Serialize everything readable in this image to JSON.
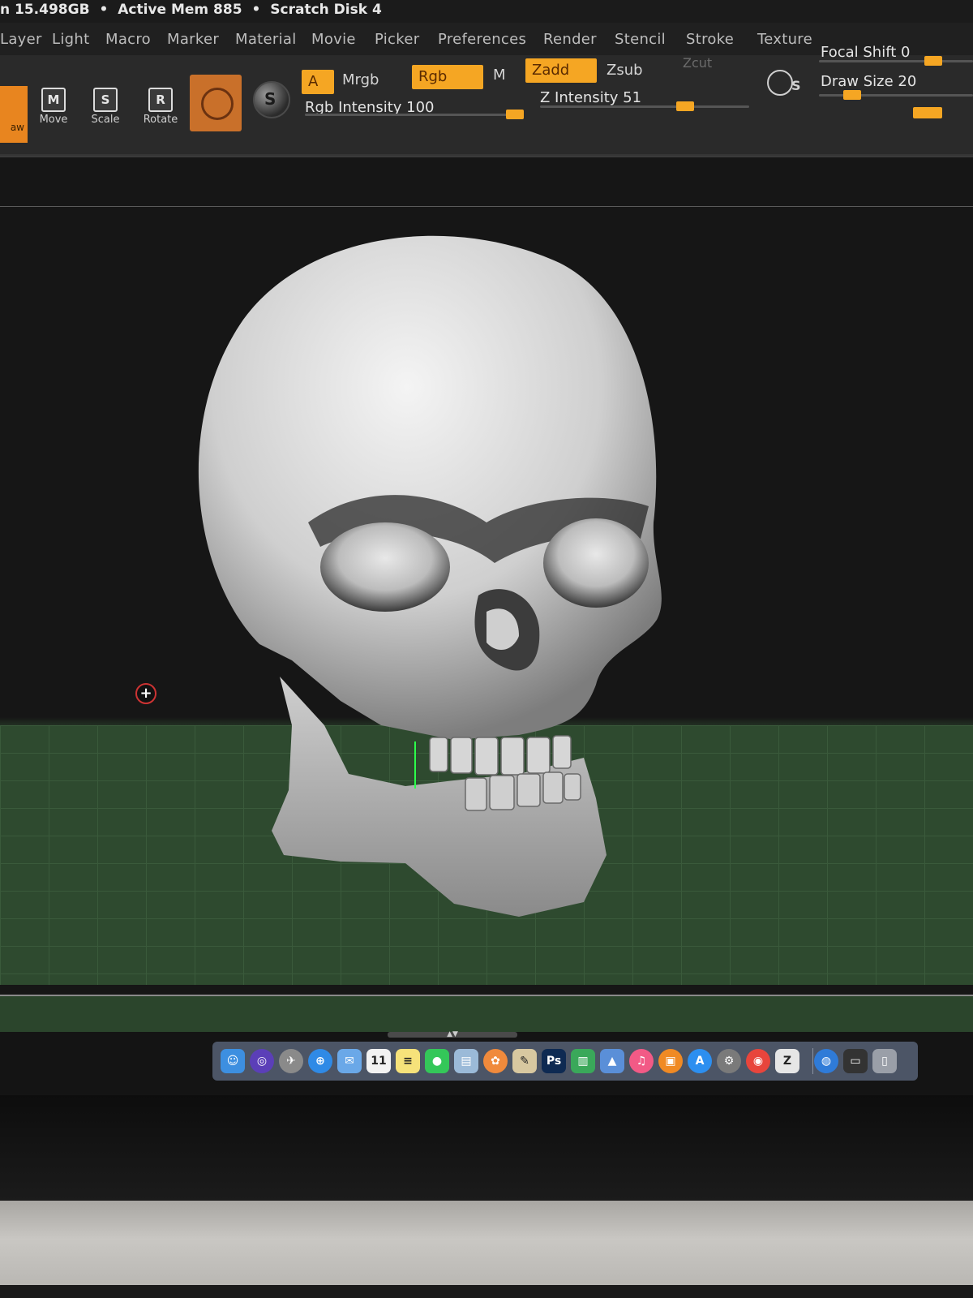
{
  "status_bar": {
    "mem_text": "n 15.498GB",
    "bullet": "•",
    "active_mem_text": "Active Mem 885",
    "scratch_text": "Scratch Disk 4"
  },
  "menu": {
    "items": [
      "Layer",
      "Light",
      "Macro",
      "Marker",
      "Material",
      "Movie",
      "Picker",
      "Preferences",
      "Render",
      "Stencil",
      "Stroke",
      "Texture"
    ]
  },
  "toolbar": {
    "draw_label": "aw",
    "move_label": "Move",
    "move_glyph": "M",
    "scale_label": "Scale",
    "scale_glyph": "S",
    "rotate_label": "Rotate",
    "rotate_glyph": "R",
    "sphere_glyph": "S",
    "a_label": "A",
    "mrgb_label": "Mrgb",
    "rgb_label": "Rgb",
    "m_label": "M",
    "zadd_label": "Zadd",
    "zsub_label": "Zsub",
    "zcut_label": "Zcut",
    "rgb_intensity_label": "Rgb Intensity 100",
    "rgb_intensity_value": 100,
    "z_intensity_label": "Z Intensity 51",
    "z_intensity_value": 51,
    "focal_shift_label": "Focal Shift 0",
    "focal_shift_value": 0,
    "draw_size_label": "Draw Size 20",
    "draw_size_value": 20,
    "brush_glyph": "S"
  },
  "viewport": {
    "cursor_glyph": "+"
  },
  "dock": {
    "handle_glyph": "▲▼",
    "apps": [
      {
        "name": "finder-icon",
        "glyph": "☺",
        "color": "#3d8fe0"
      },
      {
        "name": "siri-icon",
        "glyph": "◎",
        "color": "#5b3fb8"
      },
      {
        "name": "launchpad-icon",
        "glyph": "✈",
        "color": "#8a8a8a"
      },
      {
        "name": "safari-icon",
        "glyph": "⊕",
        "color": "#2f8ae6"
      },
      {
        "name": "mail-icon",
        "glyph": "✉",
        "color": "#6aa8e8"
      },
      {
        "name": "calendar-icon",
        "glyph": "11",
        "color": "#f2f2f2"
      },
      {
        "name": "notes-icon",
        "glyph": "≡",
        "color": "#f6e27a"
      },
      {
        "name": "facetime-icon",
        "glyph": "●",
        "color": "#34c759"
      },
      {
        "name": "preview-icon",
        "glyph": "▤",
        "color": "#9bbad8"
      },
      {
        "name": "photos-icon",
        "glyph": "✿",
        "color": "#f08a3c"
      },
      {
        "name": "script-editor-icon",
        "glyph": "✎",
        "color": "#d8c8a0"
      },
      {
        "name": "photoshop-icon",
        "glyph": "Ps",
        "color": "#0e2a52"
      },
      {
        "name": "numbers-icon",
        "glyph": "▥",
        "color": "#3aa85a"
      },
      {
        "name": "keynote-icon",
        "glyph": "▲",
        "color": "#5a8fd8"
      },
      {
        "name": "itunes-icon",
        "glyph": "♫",
        "color": "#f25a86"
      },
      {
        "name": "ibooks-icon",
        "glyph": "▣",
        "color": "#f08a24"
      },
      {
        "name": "app-store-icon",
        "glyph": "A",
        "color": "#2c8ff0"
      },
      {
        "name": "system-preferences-icon",
        "glyph": "⚙",
        "color": "#7a7a7a"
      },
      {
        "name": "chrome-icon",
        "glyph": "◉",
        "color": "#e8453c"
      },
      {
        "name": "zbrush-icon",
        "glyph": "Z",
        "color": "#e6e6e6"
      },
      {
        "name": "downloads-icon",
        "glyph": "◍",
        "color": "#2f7bd8"
      },
      {
        "name": "screenshot-stack-icon",
        "glyph": "▭",
        "color": "#333333"
      },
      {
        "name": "trash-icon",
        "glyph": "▯",
        "color": "#9a9fa8"
      }
    ]
  },
  "colors": {
    "accent": "#f5a623",
    "floor": "#2e4a2f",
    "axis": "#2cff4a"
  }
}
